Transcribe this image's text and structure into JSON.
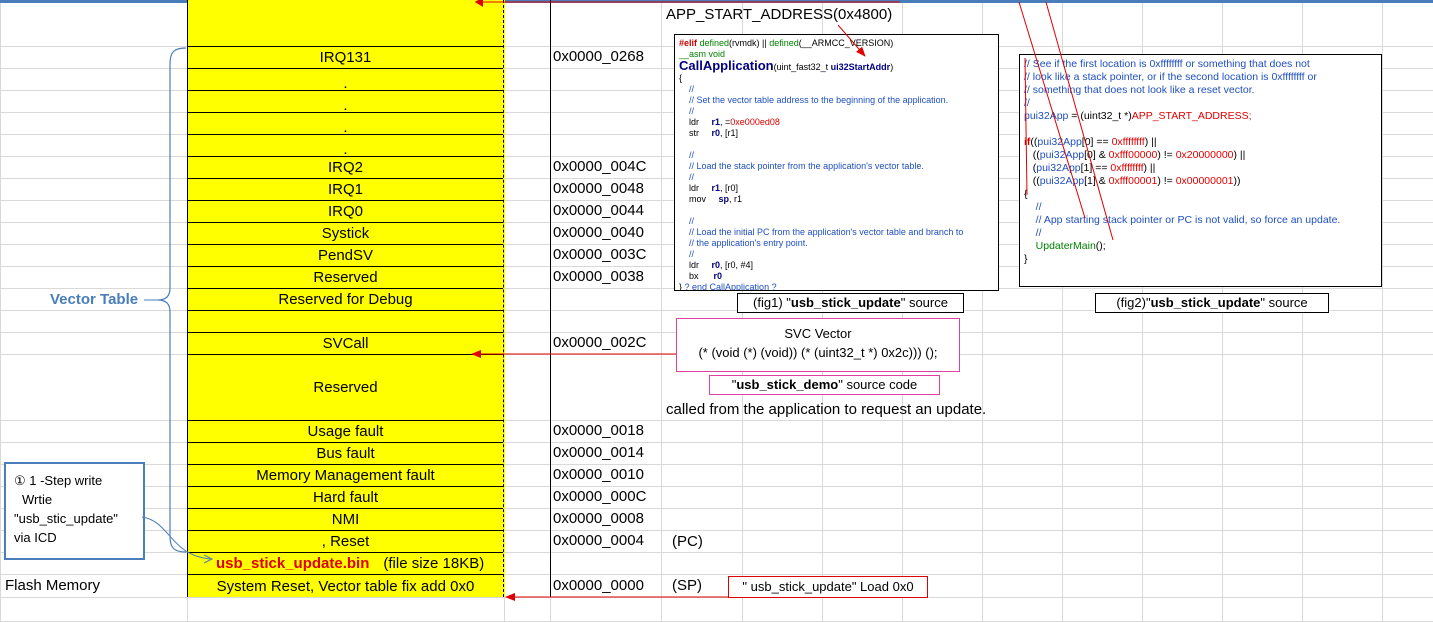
{
  "vector_table": {
    "side_label": "Vector Table",
    "rows": [
      {
        "label": "",
        "address": ""
      },
      {
        "label": "IRQ131",
        "address": "0x0000_0268"
      },
      {
        "label": ".",
        "address": ""
      },
      {
        "label": ".",
        "address": ""
      },
      {
        "label": ".",
        "address": ""
      },
      {
        "label": ".",
        "address": ""
      },
      {
        "label": "IRQ2",
        "address": "0x0000_004C"
      },
      {
        "label": "IRQ1",
        "address": "0x0000_0048"
      },
      {
        "label": "IRQ0",
        "address": "0x0000_0044"
      },
      {
        "label": "Systick",
        "address": "0x0000_0040"
      },
      {
        "label": "PendSV",
        "address": "0x0000_003C"
      },
      {
        "label": "Reserved",
        "address": "0x0000_0038"
      },
      {
        "label": "Reserved for Debug",
        "address": ""
      },
      {
        "label": "",
        "address": ""
      },
      {
        "label": "SVCall",
        "address": "0x0000_002C"
      },
      {
        "label": "Reserved",
        "address": ""
      },
      {
        "label": "Usage fault",
        "address": "0x0000_0018"
      },
      {
        "label": "Bus fault",
        "address": "0x0000_0014"
      },
      {
        "label": "Memory Management fault",
        "address": "0x0000_0010"
      },
      {
        "label": "Hard fault",
        "address": "0x0000_000C"
      },
      {
        "label": "NMI",
        "address": "0x0000_0008"
      },
      {
        "label": ", Reset",
        "address": "0x0000_0004"
      },
      {
        "label": "usb_stick_update.bin",
        "label_suffix": "(file size 18KB)",
        "address": ""
      },
      {
        "label": "System Reset, Vector table fix add 0x0",
        "address": "0x0000_0000"
      }
    ]
  },
  "notes": {
    "app_start": "APP_START_ADDRESS(0x4800)",
    "called_from": "called from the application to request an update.",
    "pc": "(PC)",
    "sp": "(SP)",
    "flash_memory": "Flash Memory",
    "step_box": [
      "① 1 -Step write",
      "Wrtie",
      "\"usb_stic_update\"",
      "via  ICD"
    ]
  },
  "svc_box": {
    "title": "SVC Vector",
    "code": "(* (void (*) (void)) (* (uint32_t *) 0x2c))) ();",
    "caption_quote_open": "\"",
    "caption_name": "usb_stick_demo",
    "caption_rest": "\"  source code"
  },
  "load_box": {
    "text": "\" usb_stick_update\" Load 0x0"
  },
  "fig1": {
    "caption_prefix": "(fig1) \"",
    "caption_name": "usb_stick_update",
    "caption_suffix": "\" source",
    "lines": [
      {
        "parts": [
          {
            "t": "#elif",
            "c": "c-kw"
          },
          {
            "t": " defined",
            "c": "c-green"
          },
          {
            "t": "(rvmdk) || ",
            "c": ""
          },
          {
            "t": "defined",
            "c": "c-green"
          },
          {
            "t": "(__ARMCC_VERSION)",
            "c": ""
          }
        ]
      },
      {
        "parts": [
          {
            "t": "__asm void",
            "c": "c-green"
          }
        ]
      },
      {
        "parts": [
          {
            "t": "CallApplication",
            "c": "c-navy big"
          },
          {
            "t": "(uint_fast32_t ",
            "c": ""
          },
          {
            "t": "ui32StartAddr",
            "c": "c-navy"
          },
          {
            "t": ")",
            "c": ""
          }
        ]
      },
      {
        "parts": [
          {
            "t": "{",
            "c": ""
          }
        ]
      },
      {
        "parts": [
          {
            "t": "    //",
            "c": "c-blue"
          }
        ]
      },
      {
        "parts": [
          {
            "t": "    // Set the vector table address to the beginning of the application.",
            "c": "c-blue"
          }
        ]
      },
      {
        "parts": [
          {
            "t": "    //",
            "c": "c-blue"
          }
        ]
      },
      {
        "parts": [
          {
            "t": "    ldr     ",
            "c": ""
          },
          {
            "t": "r1",
            "c": "c-navy"
          },
          {
            "t": ", =",
            "c": ""
          },
          {
            "t": "0xe000ed08",
            "c": "c-red"
          }
        ]
      },
      {
        "parts": [
          {
            "t": "    str     ",
            "c": ""
          },
          {
            "t": "r0",
            "c": "c-navy"
          },
          {
            "t": ", [r1]",
            "c": ""
          }
        ]
      },
      {
        "parts": [
          {
            "t": " ",
            "c": ""
          }
        ]
      },
      {
        "parts": [
          {
            "t": "    //",
            "c": "c-blue"
          }
        ]
      },
      {
        "parts": [
          {
            "t": "    // Load the stack pointer from the application's vector table.",
            "c": "c-blue"
          }
        ]
      },
      {
        "parts": [
          {
            "t": "    //",
            "c": "c-blue"
          }
        ]
      },
      {
        "parts": [
          {
            "t": "    ldr     ",
            "c": ""
          },
          {
            "t": "r1",
            "c": "c-navy"
          },
          {
            "t": ", [r0]",
            "c": ""
          }
        ]
      },
      {
        "parts": [
          {
            "t": "    mov     ",
            "c": ""
          },
          {
            "t": "sp",
            "c": "c-navy"
          },
          {
            "t": ", r1",
            "c": ""
          }
        ]
      },
      {
        "parts": [
          {
            "t": " ",
            "c": ""
          }
        ]
      },
      {
        "parts": [
          {
            "t": "    //",
            "c": "c-blue"
          }
        ]
      },
      {
        "parts": [
          {
            "t": "    // Load the initial PC from the application's vector table and branch to",
            "c": "c-blue"
          }
        ]
      },
      {
        "parts": [
          {
            "t": "    // the application's entry point.",
            "c": "c-blue"
          }
        ]
      },
      {
        "parts": [
          {
            "t": "    //",
            "c": "c-blue"
          }
        ]
      },
      {
        "parts": [
          {
            "t": "    ldr     ",
            "c": ""
          },
          {
            "t": "r0",
            "c": "c-navy"
          },
          {
            "t": ", [r0, #4]",
            "c": ""
          }
        ]
      },
      {
        "parts": [
          {
            "t": "    bx      ",
            "c": ""
          },
          {
            "t": "r0",
            "c": "c-navy"
          }
        ]
      },
      {
        "parts": [
          {
            "t": "} ",
            "c": ""
          },
          {
            "t": "? end CallApplication ?",
            "c": "c-blue"
          }
        ]
      }
    ]
  },
  "fig2": {
    "caption_prefix": "(fig2)\"",
    "caption_name": "usb_stick_update",
    "caption_suffix": "\" source",
    "lines": [
      {
        "parts": [
          {
            "t": "// See if the first location is 0xffffffff or something that does not",
            "c": "c-blue"
          }
        ]
      },
      {
        "parts": [
          {
            "t": "// look like a stack pointer, or if the second location is 0xffffffff or",
            "c": "c-blue"
          }
        ]
      },
      {
        "parts": [
          {
            "t": "// something that does not look like a reset vector.",
            "c": "c-blue"
          }
        ]
      },
      {
        "parts": [
          {
            "t": "//",
            "c": "c-blue"
          }
        ]
      },
      {
        "parts": [
          {
            "t": "pui32App",
            "c": "c-blue"
          },
          {
            "t": " = (uint32_t *)",
            "c": ""
          },
          {
            "t": "APP_START_ADDRESS;",
            "c": "c-red"
          }
        ]
      },
      {
        "parts": [
          {
            "t": " ",
            "c": ""
          }
        ]
      },
      {
        "parts": [
          {
            "t": "if",
            "c": "c-kw"
          },
          {
            "t": "((",
            "c": ""
          },
          {
            "t": "pui32App",
            "c": "c-blue"
          },
          {
            "t": "[0] == ",
            "c": ""
          },
          {
            "t": "0xffffffff",
            "c": "c-red"
          },
          {
            "t": ") ||",
            "c": ""
          }
        ]
      },
      {
        "parts": [
          {
            "t": "   ((",
            "c": ""
          },
          {
            "t": "pui32App",
            "c": "c-blue"
          },
          {
            "t": "[0] & ",
            "c": ""
          },
          {
            "t": "0xfff00000",
            "c": "c-red"
          },
          {
            "t": ") != ",
            "c": ""
          },
          {
            "t": "0x20000000",
            "c": "c-red"
          },
          {
            "t": ") ||",
            "c": ""
          }
        ]
      },
      {
        "parts": [
          {
            "t": "   (",
            "c": ""
          },
          {
            "t": "pui32App",
            "c": "c-blue"
          },
          {
            "t": "[1] == ",
            "c": ""
          },
          {
            "t": "0xffffffff",
            "c": "c-red"
          },
          {
            "t": ") ||",
            "c": ""
          }
        ]
      },
      {
        "parts": [
          {
            "t": "   ((",
            "c": ""
          },
          {
            "t": "pui32App",
            "c": "c-blue"
          },
          {
            "t": "[1] & ",
            "c": ""
          },
          {
            "t": "0xfff00001",
            "c": "c-red"
          },
          {
            "t": ") != ",
            "c": ""
          },
          {
            "t": "0x00000001",
            "c": "c-red"
          },
          {
            "t": "))",
            "c": ""
          }
        ]
      },
      {
        "parts": [
          {
            "t": "{",
            "c": ""
          }
        ]
      },
      {
        "parts": [
          {
            "t": "    //",
            "c": "c-blue"
          }
        ]
      },
      {
        "parts": [
          {
            "t": "    // App starting stack pointer or PC is not valid, so force an update.",
            "c": "c-blue"
          }
        ]
      },
      {
        "parts": [
          {
            "t": "    //",
            "c": "c-blue"
          }
        ]
      },
      {
        "parts": [
          {
            "t": "    UpdaterMain",
            "c": "c-green"
          },
          {
            "t": "();",
            "c": ""
          }
        ]
      },
      {
        "parts": [
          {
            "t": "}",
            "c": ""
          }
        ]
      }
    ]
  }
}
